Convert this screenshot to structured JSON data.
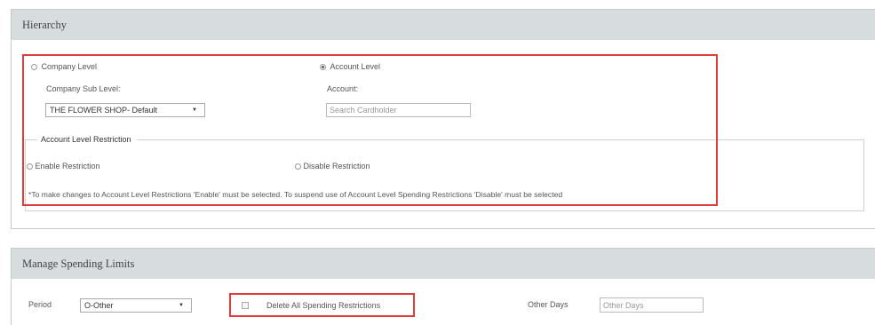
{
  "hierarchy": {
    "title": "Hierarchy",
    "company_level_label": "Company Level",
    "company_sub_level_label": "Company Sub Level:",
    "company_sub_level_value": "THE FLOWER SHOP- Default",
    "account_level_label": "Account Level",
    "account_label": "Account:",
    "account_placeholder": "Search Cardholder",
    "selected_level": "account",
    "restriction": {
      "legend": "Account Level Restriction",
      "enable_label": "Enable Restriction",
      "disable_label": "Disable Restriction",
      "note": "*To make changes to Account Level Restrictions 'Enable' must be selected. To suspend use of Account Level Spending Restrictions 'Disable' must be selected"
    }
  },
  "spending": {
    "title": "Manage Spending Limits",
    "period_label": "Period",
    "period_value": "O-Other",
    "delete_all_label": "Delete All Spending Restrictions",
    "other_days_label": "Other Days",
    "other_days_placeholder": "Other Days"
  },
  "colors": {
    "header_bg": "#d7dcdf",
    "highlight": "#e03c3c"
  }
}
